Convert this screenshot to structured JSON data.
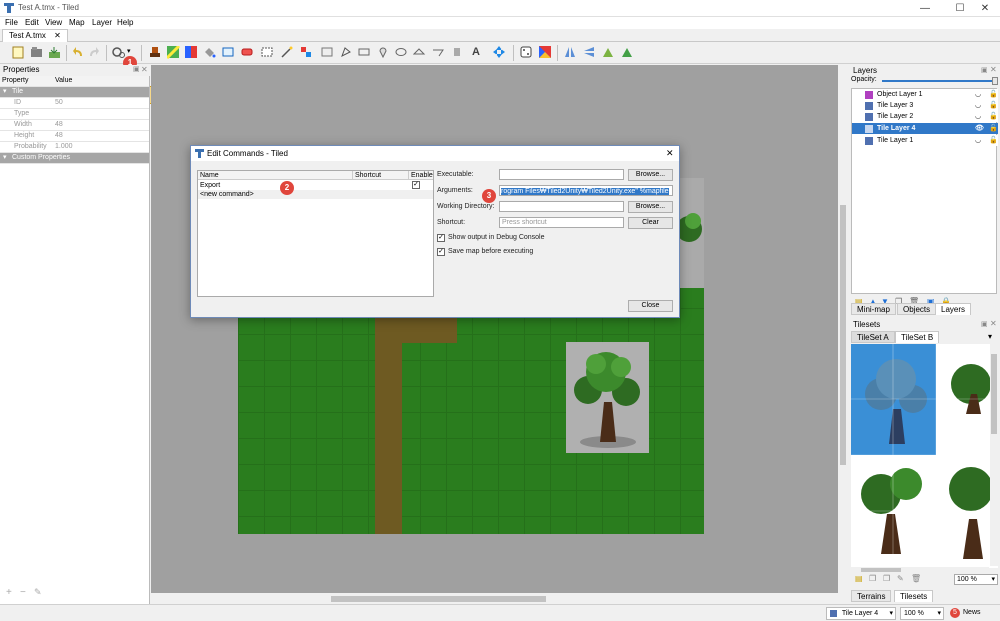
{
  "window": {
    "title": "Test A.tmx - Tiled",
    "minimize": "—",
    "maximize": "☐",
    "close": "✕"
  },
  "menu": [
    "File",
    "Edit",
    "View",
    "Map",
    "Layer",
    "Help"
  ],
  "tabs": [
    {
      "label": "Test A.tmx",
      "close": "✕"
    }
  ],
  "annotations": {
    "one": "1",
    "two": "2",
    "three": "3"
  },
  "properties": {
    "title": "Properties",
    "col_property": "Property",
    "col_value": "Value",
    "group_tile": "Tile",
    "rows": [
      {
        "k": "ID",
        "v": "50"
      },
      {
        "k": "Type",
        "v": ""
      },
      {
        "k": "Width",
        "v": "48"
      },
      {
        "k": "Height",
        "v": "48"
      },
      {
        "k": "Probability",
        "v": "1.000"
      }
    ],
    "group_custom": "Custom Properties",
    "footer": {
      "add": "+",
      "remove": "−",
      "edit": "✎"
    }
  },
  "dialog": {
    "title": "Edit Commands - Tiled",
    "close": "✕",
    "columns": {
      "name": "Name",
      "shortcut": "Shortcut",
      "enable": "Enable"
    },
    "commands": [
      {
        "name": "Export",
        "shortcut": "",
        "enabled": "✓"
      },
      {
        "name": "<new command>",
        "shortcut": "",
        "enabled": ""
      }
    ],
    "executable_label": "Executable:",
    "executable_value": "",
    "browse1": "Browse...",
    "arguments_label": "Arguments:",
    "arguments_value": "rogram Files₩Tiled2Unity₩Tiled2Unity.exe\" %mapfile",
    "working_dir_label": "Working Directory:",
    "working_dir_value": "",
    "browse2": "Browse...",
    "shortcut_label": "Shortcut:",
    "shortcut_placeholder": "Press shortcut",
    "clear": "Clear",
    "show_output": "Show output in Debug Console",
    "save_map": "Save map before executing",
    "check_mark": "✓",
    "close_button": "Close"
  },
  "layers": {
    "title": "Layers",
    "opacity_label": "Opacity:",
    "opacity": 1.0,
    "items": [
      {
        "name": "Object Layer 1",
        "selected": false
      },
      {
        "name": "Tile Layer 3",
        "selected": false
      },
      {
        "name": "Tile Layer 2",
        "selected": false
      },
      {
        "name": "Tile Layer 4",
        "selected": true
      },
      {
        "name": "Tile Layer 1",
        "selected": false
      }
    ],
    "tabs": [
      "Mini-map",
      "Objects",
      "Layers"
    ]
  },
  "tilesets": {
    "title": "Tilesets",
    "tabs": [
      "TileSet A",
      "TileSet B"
    ],
    "zoom": "100 %",
    "bottom_tabs": [
      "Terrains",
      "Tilesets"
    ]
  },
  "status": {
    "layer": "Tile Layer 4",
    "zoom": "100 %",
    "news_count": "5",
    "news": "News"
  },
  "colors": {
    "accent": "#3078c8",
    "grass": "#2a7d1e",
    "path": "#6e5a22",
    "badge": "#e0463c"
  }
}
